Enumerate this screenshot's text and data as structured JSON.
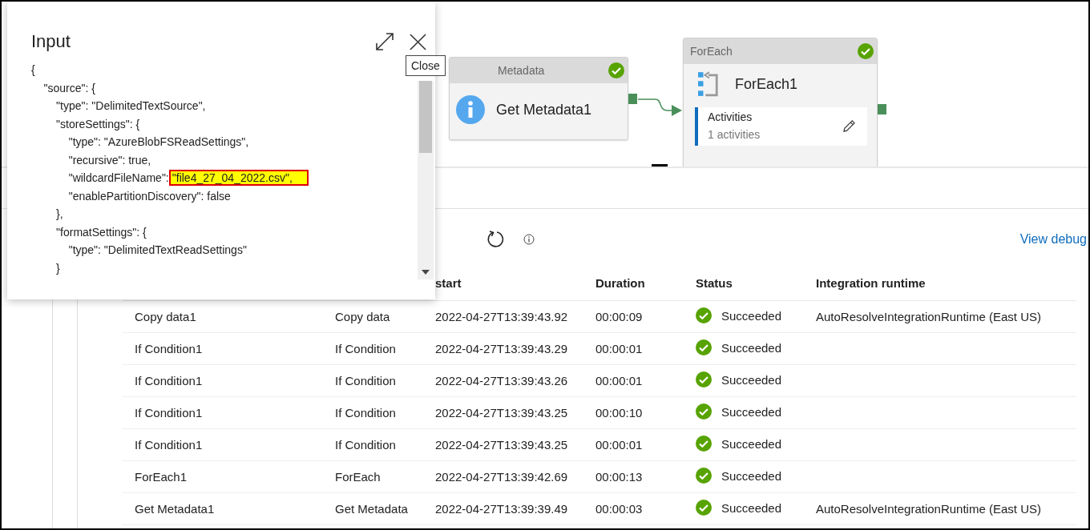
{
  "pipeline_canvas": {
    "activities": [
      {
        "kind": "get_metadata",
        "header": "Metadata",
        "name": "Get Metadata1",
        "succeeded": true
      },
      {
        "kind": "foreach",
        "header": "ForEach",
        "name": "ForEach1",
        "succeeded": true,
        "inner": {
          "title": "Activities",
          "count": "1 activities"
        }
      }
    ]
  },
  "output_panel": {
    "view_link": "View debug",
    "table": {
      "columns": [
        "start",
        "Duration",
        "Status",
        "Integration runtime"
      ],
      "rows": [
        {
          "name": "Copy data1",
          "type": "Copy data",
          "start": "2022-04-27T13:39:43.92",
          "duration": "00:00:09",
          "status": "Succeeded",
          "runtime": "AutoResolveIntegrationRuntime (East US)"
        },
        {
          "name": "If Condition1",
          "type": "If Condition",
          "start": "2022-04-27T13:39:43.29",
          "duration": "00:00:01",
          "status": "Succeeded"
        },
        {
          "name": "If Condition1",
          "type": "If Condition",
          "start": "2022-04-27T13:39:43.26",
          "duration": "00:00:01",
          "status": "Succeeded"
        },
        {
          "name": "If Condition1",
          "type": "If Condition",
          "start": "2022-04-27T13:39:43.25",
          "duration": "00:00:10",
          "status": "Succeeded"
        },
        {
          "name": "If Condition1",
          "type": "If Condition",
          "start": "2022-04-27T13:39:43.25",
          "duration": "00:00:01",
          "status": "Succeeded"
        },
        {
          "name": "ForEach1",
          "type": "ForEach",
          "start": "2022-04-27T13:39:42.69",
          "duration": "00:00:13",
          "status": "Succeeded"
        },
        {
          "name": "Get Metadata1",
          "type": "Get Metadata",
          "start": "2022-04-27T13:39:39.49",
          "duration": "00:00:03",
          "status": "Succeeded",
          "runtime": "AutoResolveIntegrationRuntime (East US)"
        }
      ]
    }
  },
  "input_dialog": {
    "title": "Input",
    "tooltip": "Close",
    "lines": [
      {
        "text": "{"
      },
      {
        "text": "    \"source\": {"
      },
      {
        "text": "        \"type\": \"DelimitedTextSource\","
      },
      {
        "text": "        \"storeSettings\": {"
      },
      {
        "text": "            \"type\": \"AzureBlobFSReadSettings\","
      },
      {
        "text": "            \"recursive\": true,"
      },
      {
        "text": "            \"wildcardFileName\":",
        "highlight": "\"file4_27_04_2022.csv\","
      },
      {
        "text": "            \"enablePartitionDiscovery\": false"
      },
      {
        "text": "        },"
      },
      {
        "text": "        \"formatSettings\": {"
      },
      {
        "text": "            \"type\": \"DelimitedTextReadSettings\""
      },
      {
        "text": "        }"
      }
    ]
  }
}
